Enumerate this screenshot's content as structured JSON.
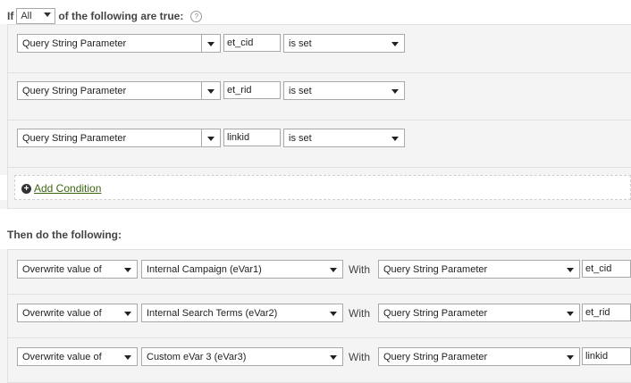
{
  "header": {
    "if_label": "If",
    "match_mode": "All",
    "suffix": "of the following are true:",
    "help_icon": "help-circle-icon"
  },
  "conditions": [
    {
      "type": "Query String Parameter",
      "value": "et_cid",
      "operator": "is set"
    },
    {
      "type": "Query String Parameter",
      "value": "et_rid",
      "operator": "is set"
    },
    {
      "type": "Query String Parameter",
      "value": "linkid",
      "operator": "is set"
    }
  ],
  "add_condition": {
    "label": "Add Condition",
    "icon": "plus-circle-icon"
  },
  "then_label": "Then do the following:",
  "actions": [
    {
      "action": "Overwrite value of",
      "variable": "Internal Campaign (eVar1)",
      "with": "With",
      "source": "Query String Parameter",
      "param": "et_cid"
    },
    {
      "action": "Overwrite value of",
      "variable": "Internal Search Terms (eVar2)",
      "with": "With",
      "source": "Query String Parameter",
      "param": "et_rid"
    },
    {
      "action": "Overwrite value of",
      "variable": "Custom eVar 3 (eVar3)",
      "with": "With",
      "source": "Query String Parameter",
      "param": "linkid"
    }
  ]
}
